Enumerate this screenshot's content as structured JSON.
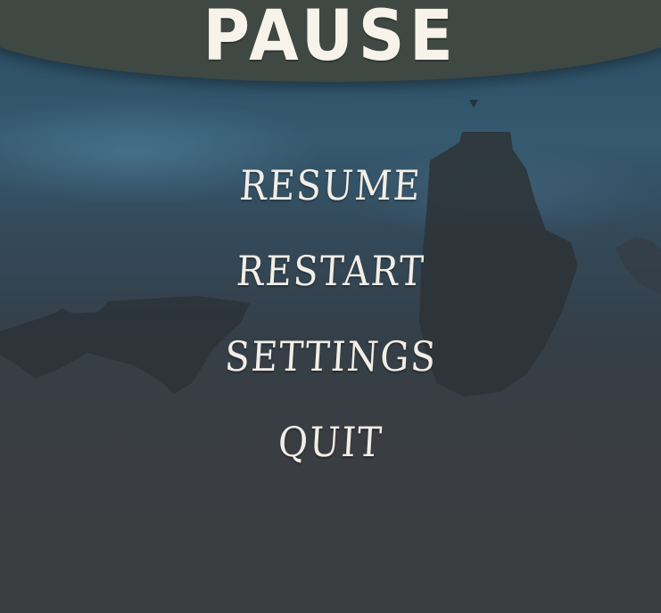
{
  "pause_menu": {
    "title": "PAUSE",
    "items": [
      {
        "id": "resume",
        "label": "RESUME"
      },
      {
        "id": "restart",
        "label": "RESTART"
      },
      {
        "id": "settings",
        "label": "SETTINGS"
      },
      {
        "id": "quit",
        "label": "QUIT"
      }
    ]
  },
  "colors": {
    "banner": "#3f4843",
    "text": "#f2eee6",
    "sky_top": "#2b4d62",
    "overlay_bottom": "#3c3d40"
  }
}
